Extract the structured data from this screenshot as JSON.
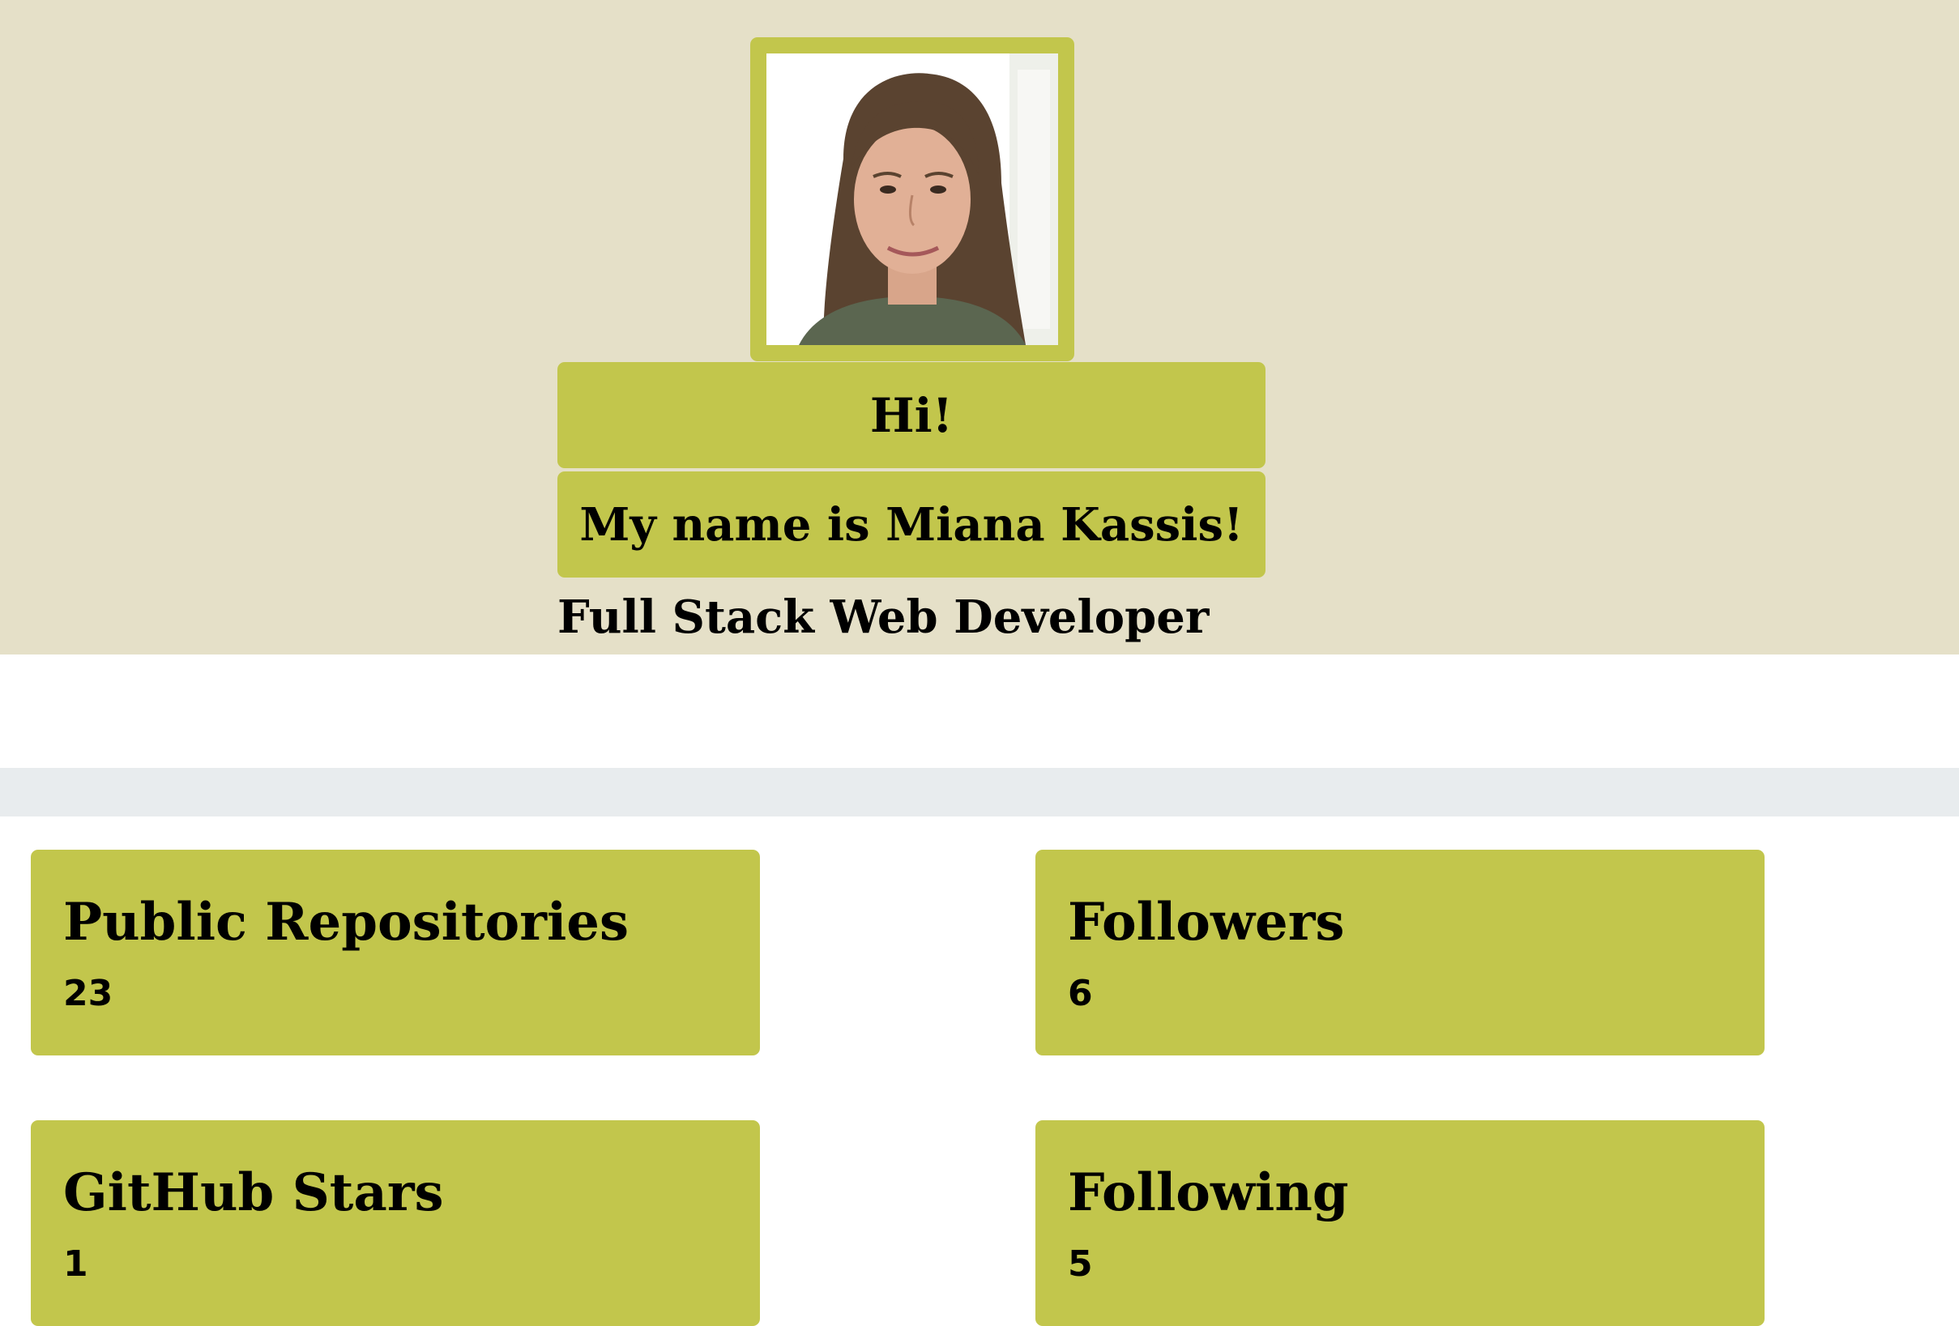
{
  "profile": {
    "greeting": "Hi!",
    "name_line": "My name is Miana Kassis!",
    "role": "Full Stack Web Developer",
    "avatar_icon": "profile-photo"
  },
  "stats": [
    {
      "label": "Public Repositories",
      "value": "23"
    },
    {
      "label": "Followers",
      "value": "6"
    },
    {
      "label": "GitHub Stars",
      "value": "1"
    },
    {
      "label": "Following",
      "value": "5"
    }
  ],
  "colors": {
    "hero_background": "#e5e0c8",
    "accent": "#c2c64c",
    "divider": "#e8ecee",
    "page_background": "#ffffff",
    "text": "#000000"
  }
}
